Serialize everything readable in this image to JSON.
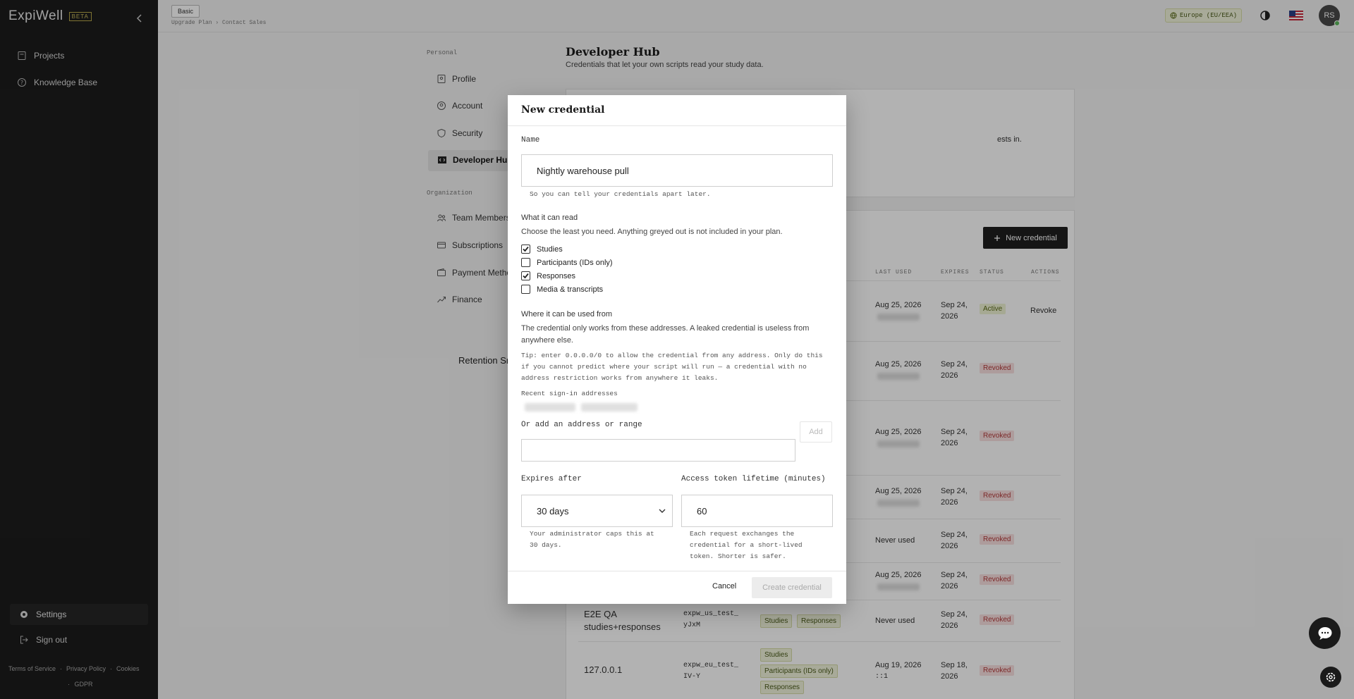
{
  "app": {
    "logo": "ExpiWell",
    "badge": "BETA"
  },
  "sidebar": {
    "items": [
      {
        "label": "Projects"
      },
      {
        "label": "Knowledge Base"
      }
    ],
    "settings_label": "Settings",
    "signout_label": "Sign out",
    "footer": {
      "terms": "Terms of Service",
      "privacy": "Privacy Policy",
      "cookies": "Cookies",
      "gdpr": "GDPR",
      "sep": "·"
    }
  },
  "topbar": {
    "plan": "Basic",
    "upgrade": "Upgrade Plan",
    "arrow": "›",
    "contact": "Contact Sales",
    "region": "Europe (EU/EEA)",
    "avatar": "RS"
  },
  "settings_nav": {
    "personal": "Personal",
    "organization": "Organization",
    "personal_items": [
      "Profile",
      "Account",
      "Security",
      "Developer Hub"
    ],
    "org_items": [
      "Team Members",
      "Subscriptions",
      "Payment Metho",
      "Finance"
    ]
  },
  "page": {
    "title": "Developer Hub",
    "subtitle": "Credentials that let your own scripts read your study data.",
    "card_fragment": "ests in.",
    "new_credential": "New credential",
    "retention": "Retention Sr"
  },
  "table": {
    "headers": [
      "LAST USED",
      "EXPIRES",
      "STATUS",
      "ACTIONS"
    ],
    "rows": [
      {
        "last_used": "Aug 25, 2026",
        "expires1": "Sep 24,",
        "expires2": "2026",
        "status": "Active",
        "action": "Revoke"
      },
      {
        "last_used": "Aug 25, 2026",
        "expires1": "Sep 24,",
        "expires2": "2026",
        "status": "Revoked"
      },
      {
        "last_used": "Aug 25, 2026",
        "expires1": "Sep 24,",
        "expires2": "2026",
        "status": "Revoked"
      },
      {
        "last_used": "Aug 25, 2026",
        "expires1": "Sep 24,",
        "expires2": "2026",
        "status": "Revoked"
      },
      {
        "last_used": "Never used",
        "expires1": "Sep 24,",
        "expires2": "2026",
        "status": "Revoked"
      },
      {
        "last_used": "Aug 25, 2026",
        "expires1": "Sep 24,",
        "expires2": "2026",
        "status": "Revoked"
      },
      {
        "name1": "E2E QA",
        "name2": "studies+responses",
        "prefix1": "expw_us_test_",
        "prefix2": "yJxM",
        "chips": [
          "Studies",
          "Responses"
        ],
        "last_used": "Never used",
        "expires1": "Sep 24,",
        "expires2": "2026",
        "status": "Revoked"
      },
      {
        "name1": "127.0.0.1",
        "prefix1": "expw_eu_test_",
        "prefix2": "IV-Y",
        "chips": [
          "Studies",
          "Participants (IDs only)",
          "Responses"
        ],
        "last_used": "Aug 19, 2026",
        "last_used_sub": "::1",
        "expires1": "Sep 18,",
        "expires2": "2026",
        "status": "Revoked"
      }
    ]
  },
  "modal": {
    "title": "New credential",
    "name_label": "Name",
    "name_value": "Nightly warehouse pull",
    "name_hint": "So you can tell your credentials apart later.",
    "read_title": "What it can read",
    "read_desc": "Choose the least you need. Anything greyed out is not included in your plan.",
    "scopes": [
      {
        "label": "Studies",
        "checked": true
      },
      {
        "label": "Participants (IDs only)",
        "checked": false
      },
      {
        "label": "Responses",
        "checked": true
      },
      {
        "label": "Media & transcripts",
        "checked": false
      }
    ],
    "where_title": "Where it can be used from",
    "where_desc1": "The credential only works from these addresses. A leaked credential is useless from",
    "where_desc2": "anywhere else.",
    "tip1": "Tip: enter 0.0.0.0/0 to allow the credential from any address. Only do this",
    "tip2": "if you cannot predict where your script will run — a credential with no",
    "tip3": "address restriction works from anywhere it leaks.",
    "recent_label": "Recent sign-in addresses",
    "add_label": "Or add an address or range",
    "add_button": "Add",
    "add_value": "",
    "expires_label": "Expires after",
    "expires_value": "30 days",
    "expires_hint1": "Your administrator caps this at",
    "expires_hint2": "30 days.",
    "lifetime_label": "Access token lifetime (minutes)",
    "lifetime_value": "60",
    "lifetime_hint1": "Each request exchanges the",
    "lifetime_hint2": "credential for a short-lived",
    "lifetime_hint3": "token. Shorter is safer.",
    "cancel": "Cancel",
    "create": "Create credential"
  }
}
